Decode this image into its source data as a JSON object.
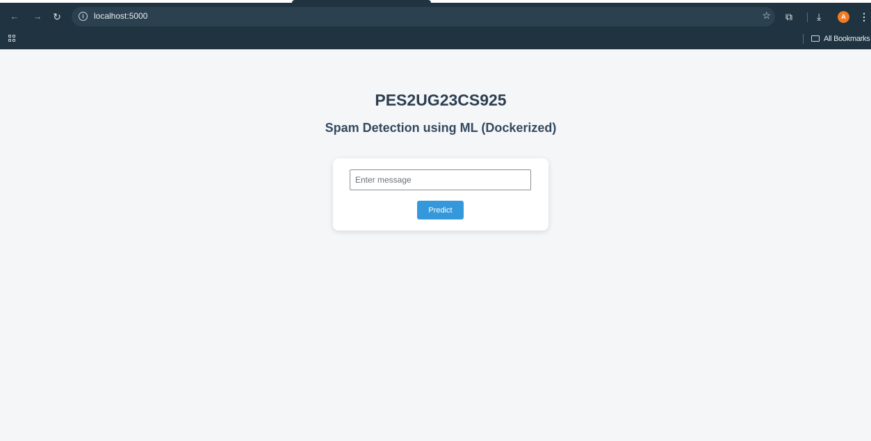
{
  "browser": {
    "url": "localhost:5000",
    "bookmarks_label": "All Bookmarks",
    "avatar_initial": "A",
    "icons": [
      "back-icon",
      "forward-icon",
      "reload-icon",
      "info-icon",
      "star-icon",
      "extensions-icon",
      "download-icon",
      "menu-icon",
      "apps-icon",
      "folder-icon"
    ]
  },
  "page": {
    "title": "PES2UG23CS925",
    "subtitle": "Spam Detection using ML (Dockerized)",
    "form": {
      "input_value": "",
      "input_placeholder": "Enter message",
      "button_label": "Predict"
    }
  },
  "colors": {
    "chrome_bg": "#1f3340",
    "page_bg": "#f4f6f8",
    "title_color": "#2c3e50",
    "button_bg": "#3498db",
    "avatar_bg": "#f47a1f"
  }
}
